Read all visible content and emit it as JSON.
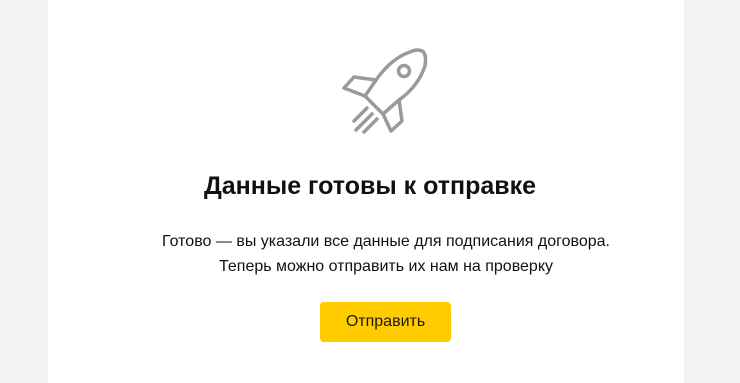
{
  "panel": {
    "title": "Данные готовы к отправке",
    "description_line1": "Готово — вы указали все данные для подписания договора.",
    "description_line2": "Теперь можно отправить их нам на проверку",
    "submit_label": "Отправить"
  },
  "icons": {
    "illustration": "rocket-icon"
  },
  "colors": {
    "background": "#f2f2f2",
    "card": "#ffffff",
    "accent_button": "#ffcc00",
    "icon_stroke": "#9a9a9a",
    "text": "#111111"
  }
}
